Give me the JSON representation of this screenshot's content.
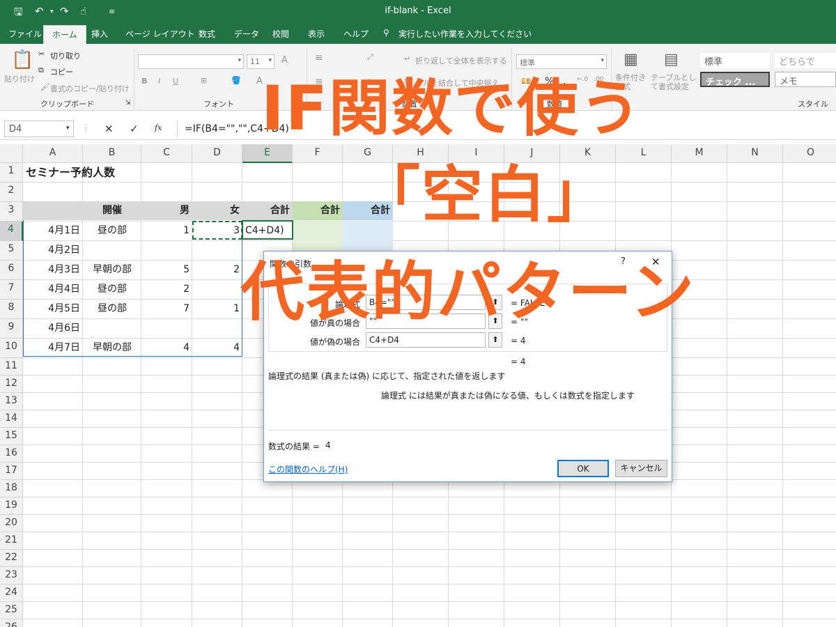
{
  "window": {
    "title": "if-blank  -  Excel"
  },
  "tabs": [
    "ファイル",
    "ホーム",
    "挿入",
    "ページ レイアウト",
    "数式",
    "データ",
    "校閲",
    "表示",
    "ヘルプ"
  ],
  "tell_me": "実行したい作業を入力してください",
  "ribbon": {
    "clipboard": {
      "paste": "貼り付け",
      "cut": "切り取り",
      "copy": "コピー",
      "format_painter": "書式のコピー/貼り付け",
      "label": "クリップボード"
    },
    "font": {
      "size": "11",
      "label": "フォント",
      "bold": "B",
      "italic": "I",
      "underline": "U"
    },
    "alignment": {
      "wrap": "折り返して全体を表示する",
      "merge": "セルを結合して中央揃え",
      "label": "配置"
    },
    "number": {
      "format": "標準",
      "label": "数値"
    },
    "styles": {
      "conditional": "条件付き書式",
      "table": "テーブルとして書式設定",
      "style1": "標準",
      "style2": "どちらでも...",
      "style3": "チェック ...",
      "style4": "メモ",
      "label": "スタイル"
    }
  },
  "formula_bar": {
    "name_box": "D4",
    "cancel": "✕",
    "enter": "✓",
    "fx": "fx",
    "formula": "=IF(B4=\"\",\"\",C4+D4)"
  },
  "columns": [
    "A",
    "B",
    "C",
    "D",
    "E",
    "F",
    "G",
    "H",
    "I",
    "J",
    "K",
    "L",
    "M",
    "N",
    "O"
  ],
  "rows": [
    "1",
    "2",
    "3",
    "4",
    "5",
    "6",
    "7",
    "8",
    "9",
    "10",
    "11",
    "12",
    "13",
    "14",
    "15",
    "16",
    "17",
    "18",
    "19",
    "20",
    "21",
    "22",
    "23",
    "24",
    "25",
    "26"
  ],
  "sheet": {
    "title": "セミナー予約人数",
    "headers": {
      "b": "開催",
      "c": "男",
      "d": "女",
      "e": "合計",
      "f": "合計",
      "g": "合計"
    },
    "data": [
      {
        "date": "4月1日",
        "session": "昼の部",
        "male": "1",
        "female": "3",
        "total": "C4+D4)"
      },
      {
        "date": "4月2日",
        "session": "",
        "male": "",
        "female": "",
        "total": ""
      },
      {
        "date": "4月3日",
        "session": "早朝の部",
        "male": "5",
        "female": "2",
        "total": ""
      },
      {
        "date": "4月4日",
        "session": "昼の部",
        "male": "2",
        "female": "",
        "total": ""
      },
      {
        "date": "4月5日",
        "session": "昼の部",
        "male": "7",
        "female": "1",
        "total": ""
      },
      {
        "date": "4月6日",
        "session": "",
        "male": "",
        "female": "",
        "total": ""
      },
      {
        "date": "4月7日",
        "session": "早朝の部",
        "male": "4",
        "female": "4",
        "total": ""
      }
    ]
  },
  "dialog": {
    "title": "関数の引数",
    "help_q": "?",
    "close": "✕",
    "args": [
      {
        "label": "論理式",
        "value": "B4=\"\"",
        "result": "=  FALSE"
      },
      {
        "label": "値が真の場合",
        "value": "\"\"",
        "result": "=  \"\""
      },
      {
        "label": "値が偽の場合",
        "value": "C4+D4",
        "result": "=  4"
      }
    ],
    "overall_result": "=  4",
    "description": "論理式の結果 (真または偽) に応じて、指定された値を返します",
    "arg_description": "論理式  には結果が真または偽になる値、もしくは数式を指定します",
    "formula_result_label": "数式の結果 =",
    "formula_result_value": "4",
    "help_link": "この関数のヘルプ(H)",
    "ok": "OK",
    "cancel": "キャンセル"
  },
  "overlay": {
    "line1": "IF関数で使う",
    "line2": "「空白」",
    "line3": "代表的パターン",
    "color": "#f26522"
  },
  "colors": {
    "excel_green": "#217346",
    "header_gray": "#d9d9d9",
    "f_green": "#e2efda",
    "g_blue": "#ddebf7"
  }
}
